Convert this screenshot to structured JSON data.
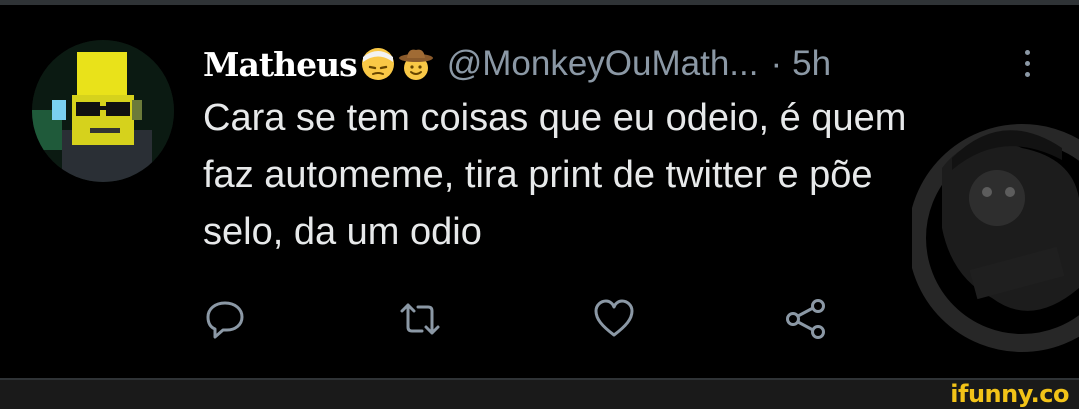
{
  "tweet": {
    "display_name": "Matheus",
    "emojis": [
      "face-with-head-bandage-emoji",
      "cowboy-hat-face-emoji"
    ],
    "handle": "@MonkeyOuMath...",
    "separator": "·",
    "time": "5h",
    "text": "Cara se tem coisas que eu odeio, é quem\nfaz automeme, tira print de twitter e põe\nselo, da um odio"
  },
  "actions": [
    {
      "name": "reply",
      "icon": "reply-icon"
    },
    {
      "name": "retweet",
      "icon": "retweet-icon"
    },
    {
      "name": "like",
      "icon": "heart-icon"
    },
    {
      "name": "share",
      "icon": "share-icon"
    }
  ],
  "footer": {
    "watermark": "ifunny.co"
  },
  "colors": {
    "background": "#000000",
    "text": "#e7e9ea",
    "secondary": "#8b98a5",
    "ifunny": "#f2c318"
  }
}
